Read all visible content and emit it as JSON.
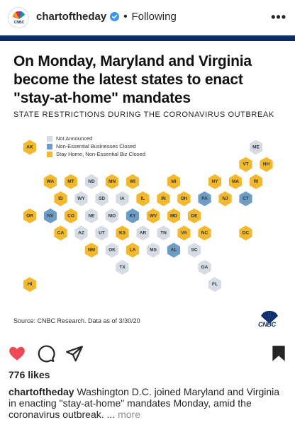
{
  "header": {
    "username": "chartoftheday",
    "separator": "•",
    "following_label": "Following",
    "more_label": "•••"
  },
  "post": {
    "headline": "On Monday, Maryland and Virginia become the latest states to enact \"stay-at-home\" mandates",
    "subhead": "STATE RESTRICTIONS DURING THE CORONAVIRUS OUTBREAK",
    "legend": [
      {
        "label": "Not Announced",
        "color": "#d6dce6"
      },
      {
        "label": "Non-Essential Businesses Closed",
        "color": "#6d9dc5"
      },
      {
        "label": "Stay Home, Non-Essential Biz Closed",
        "color": "#f2b82e"
      }
    ],
    "source": "Source: CNBC Research. Data as of 3/30/20",
    "logo_text": "CNBC",
    "states": [
      {
        "code": "AK",
        "status": 2,
        "row": 0,
        "col": 0
      },
      {
        "code": "ME",
        "status": 0,
        "row": 0,
        "col": 11
      },
      {
        "code": "VT",
        "status": 2,
        "row": 1,
        "col": 10
      },
      {
        "code": "NH",
        "status": 2,
        "row": 1,
        "col": 11
      },
      {
        "code": "WA",
        "status": 2,
        "row": 2,
        "col": 1
      },
      {
        "code": "MT",
        "status": 2,
        "row": 2,
        "col": 2
      },
      {
        "code": "ND",
        "status": 0,
        "row": 2,
        "col": 3
      },
      {
        "code": "MN",
        "status": 2,
        "row": 2,
        "col": 4
      },
      {
        "code": "WI",
        "status": 2,
        "row": 2,
        "col": 5
      },
      {
        "code": "MI",
        "status": 2,
        "row": 2,
        "col": 7
      },
      {
        "code": "NY",
        "status": 2,
        "row": 2,
        "col": 9
      },
      {
        "code": "MA",
        "status": 2,
        "row": 2,
        "col": 10
      },
      {
        "code": "RI",
        "status": 2,
        "row": 2,
        "col": 11
      },
      {
        "code": "ID",
        "status": 2,
        "row": 3,
        "col": 1
      },
      {
        "code": "WY",
        "status": 0,
        "row": 3,
        "col": 2
      },
      {
        "code": "SD",
        "status": 0,
        "row": 3,
        "col": 3
      },
      {
        "code": "IA",
        "status": 0,
        "row": 3,
        "col": 4
      },
      {
        "code": "IL",
        "status": 2,
        "row": 3,
        "col": 5
      },
      {
        "code": "IN",
        "status": 2,
        "row": 3,
        "col": 6
      },
      {
        "code": "OH",
        "status": 2,
        "row": 3,
        "col": 7
      },
      {
        "code": "PA",
        "status": 1,
        "row": 3,
        "col": 8
      },
      {
        "code": "NJ",
        "status": 2,
        "row": 3,
        "col": 9
      },
      {
        "code": "CT",
        "status": 1,
        "row": 3,
        "col": 10
      },
      {
        "code": "OR",
        "status": 2,
        "row": 4,
        "col": 0
      },
      {
        "code": "NV",
        "status": 1,
        "row": 4,
        "col": 1
      },
      {
        "code": "CO",
        "status": 2,
        "row": 4,
        "col": 2
      },
      {
        "code": "NE",
        "status": 0,
        "row": 4,
        "col": 3
      },
      {
        "code": "MO",
        "status": 0,
        "row": 4,
        "col": 4
      },
      {
        "code": "KY",
        "status": 1,
        "row": 4,
        "col": 5
      },
      {
        "code": "WV",
        "status": 2,
        "row": 4,
        "col": 6
      },
      {
        "code": "MD",
        "status": 2,
        "row": 4,
        "col": 7
      },
      {
        "code": "DE",
        "status": 2,
        "row": 4,
        "col": 8
      },
      {
        "code": "CA",
        "status": 2,
        "row": 5,
        "col": 1
      },
      {
        "code": "AZ",
        "status": 0,
        "row": 5,
        "col": 2
      },
      {
        "code": "UT",
        "status": 0,
        "row": 5,
        "col": 3
      },
      {
        "code": "KS",
        "status": 2,
        "row": 5,
        "col": 4
      },
      {
        "code": "AR",
        "status": 0,
        "row": 5,
        "col": 5
      },
      {
        "code": "TN",
        "status": 0,
        "row": 5,
        "col": 6
      },
      {
        "code": "VA",
        "status": 2,
        "row": 5,
        "col": 7
      },
      {
        "code": "NC",
        "status": 2,
        "row": 5,
        "col": 8
      },
      {
        "code": "DC",
        "status": 2,
        "row": 5,
        "col": 10
      },
      {
        "code": "NM",
        "status": 2,
        "row": 6,
        "col": 3
      },
      {
        "code": "OK",
        "status": 0,
        "row": 6,
        "col": 4
      },
      {
        "code": "LA",
        "status": 2,
        "row": 6,
        "col": 5
      },
      {
        "code": "MS",
        "status": 0,
        "row": 6,
        "col": 6
      },
      {
        "code": "AL",
        "status": 1,
        "row": 6,
        "col": 7
      },
      {
        "code": "SC",
        "status": 0,
        "row": 6,
        "col": 8
      },
      {
        "code": "TX",
        "status": 0,
        "row": 7,
        "col": 4
      },
      {
        "code": "GA",
        "status": 0,
        "row": 7,
        "col": 8
      },
      {
        "code": "HI",
        "status": 2,
        "row": 8,
        "col": 0
      },
      {
        "code": "FL",
        "status": 0,
        "row": 8,
        "col": 9
      }
    ]
  },
  "actions": {
    "like_icon_color": "#ed4956"
  },
  "likes": "776 likes",
  "caption": {
    "user": "chartoftheday",
    "text": " Washington D.C. joined Maryland and Virginia in enacting \"stay-at-home\" mandates Monday, amid the coronavirus outbreak. ... ",
    "more": "more"
  }
}
